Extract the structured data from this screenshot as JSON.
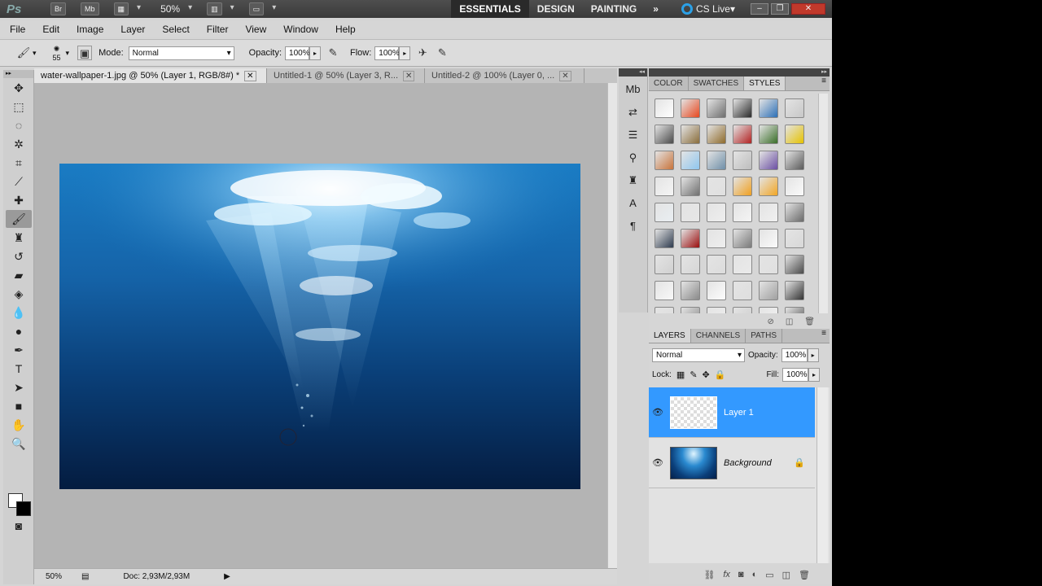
{
  "app": {
    "logo": "Ps",
    "bridge_label": "Br",
    "minibridge_label": "Mb",
    "zoom": "50%",
    "workspaces": [
      "ESSENTIALS",
      "DESIGN",
      "PAINTING"
    ],
    "more_workspaces": "»",
    "cs_live": "CS Live",
    "window_buttons": [
      "–",
      "❐",
      "✕"
    ]
  },
  "menu": [
    "File",
    "Edit",
    "Image",
    "Layer",
    "Select",
    "Filter",
    "View",
    "Window",
    "Help"
  ],
  "options": {
    "brush_size": "55",
    "mode_label": "Mode:",
    "mode_value": "Normal",
    "opacity_label": "Opacity:",
    "opacity_value": "100%",
    "flow_label": "Flow:",
    "flow_value": "100%"
  },
  "tabs": [
    {
      "label": "water-wallpaper-1.jpg @ 50% (Layer 1, RGB/8#) *",
      "active": true
    },
    {
      "label": "Untitled-1 @ 50% (Layer 3, R...",
      "active": false
    },
    {
      "label": "Untitled-2 @ 100% (Layer 0, ...",
      "active": false
    }
  ],
  "status": {
    "zoom": "50%",
    "doc": "Doc: 2,93M/2,93M"
  },
  "styles_panel": {
    "tabs": [
      "COLOR",
      "SWATCHES",
      "STYLES"
    ],
    "active_tab": "STYLES"
  },
  "layers_panel": {
    "tabs": [
      "LAYERS",
      "CHANNELS",
      "PATHS"
    ],
    "blend_mode": "Normal",
    "opacity_label": "Opacity:",
    "opacity_value": "100%",
    "lock_label": "Lock:",
    "fill_label": "Fill:",
    "fill_value": "100%",
    "layers": [
      {
        "name": "Layer 1",
        "selected": true
      },
      {
        "name": "Background",
        "selected": false,
        "locked": true
      }
    ]
  },
  "colors": {
    "accent": "#3399ff",
    "appbar": "#3f3f3f",
    "canvas_bg": "#b4b4b4"
  }
}
